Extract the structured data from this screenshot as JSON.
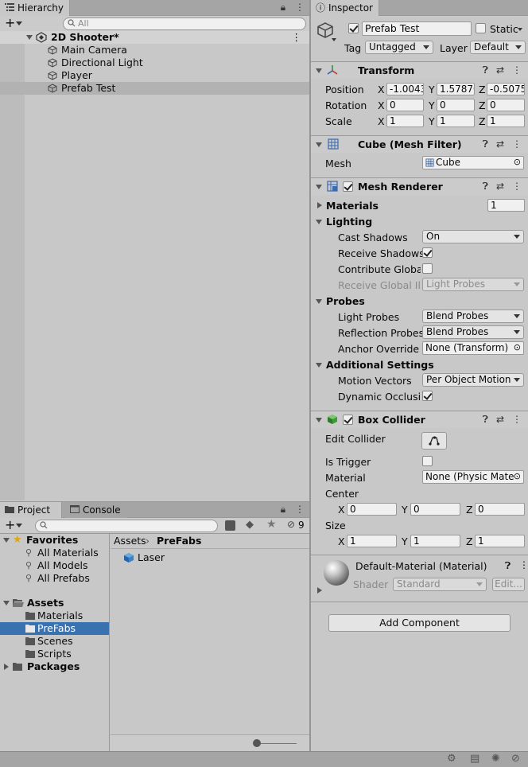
{
  "hierarchy": {
    "tab_title": "Hierarchy",
    "search_placeholder": "All",
    "scene_name": "2D Shooter*",
    "items": [
      "Main Camera",
      "Directional Light",
      "Player",
      "Prefab Test"
    ]
  },
  "project": {
    "tab_project": "Project",
    "tab_console": "Console",
    "hidden_count": "9",
    "favorites": {
      "label": "Favorites",
      "items": [
        "All Materials",
        "All Models",
        "All Prefabs"
      ]
    },
    "assets": {
      "label": "Assets",
      "items": [
        "Materials",
        "PreFabs",
        "Scenes",
        "Scripts"
      ]
    },
    "packages_label": "Packages",
    "breadcrumb": {
      "root": "Assets",
      "current": "PreFabs"
    },
    "files": [
      "Laser"
    ]
  },
  "inspector": {
    "tab_title": "Inspector",
    "object_name": "Prefab Test",
    "static_label": "Static",
    "tag_label": "Tag",
    "tag_value": "Untagged",
    "layer_label": "Layer",
    "layer_value": "Default",
    "transform": {
      "title": "Transform",
      "position_label": "Position",
      "rotation_label": "Rotation",
      "scale_label": "Scale",
      "position": [
        "-1.0043",
        "1.57870",
        "-0.5075"
      ],
      "rotation": [
        "0",
        "0",
        "0"
      ],
      "scale": [
        "1",
        "1",
        "1"
      ]
    },
    "mesh_filter": {
      "title": "Cube (Mesh Filter)",
      "mesh_label": "Mesh",
      "mesh_value": "Cube"
    },
    "mesh_renderer": {
      "title": "Mesh Renderer",
      "materials_label": "Materials",
      "materials_count": "1",
      "lighting_label": "Lighting",
      "cast_shadows_label": "Cast Shadows",
      "cast_shadows_value": "On",
      "receive_shadows_label": "Receive Shadows",
      "contribute_gi_label": "Contribute Global I",
      "receive_gi_label": "Receive Global Illu",
      "receive_gi_value": "Light Probes",
      "probes_label": "Probes",
      "light_probes_label": "Light Probes",
      "light_probes_value": "Blend Probes",
      "reflection_probes_label": "Reflection Probes",
      "reflection_probes_value": "Blend Probes",
      "anchor_override_label": "Anchor Override",
      "anchor_override_value": "None (Transform)",
      "additional_label": "Additional Settings",
      "motion_vectors_label": "Motion Vectors",
      "motion_vectors_value": "Per Object Motion",
      "dynamic_occlusion_label": "Dynamic Occlusion"
    },
    "box_collider": {
      "title": "Box Collider",
      "edit_collider_label": "Edit Collider",
      "is_trigger_label": "Is Trigger",
      "material_label": "Material",
      "material_value": "None (Physic Mate",
      "center_label": "Center",
      "center": [
        "0",
        "0",
        "0"
      ],
      "size_label": "Size",
      "size": [
        "1",
        "1",
        "1"
      ]
    },
    "material": {
      "title": "Default-Material (Material)",
      "shader_label": "Shader",
      "shader_value": "Standard",
      "edit_label": "Edit..."
    },
    "add_component_label": "Add Component"
  },
  "axis": {
    "x": "X",
    "y": "Y",
    "z": "Z"
  }
}
